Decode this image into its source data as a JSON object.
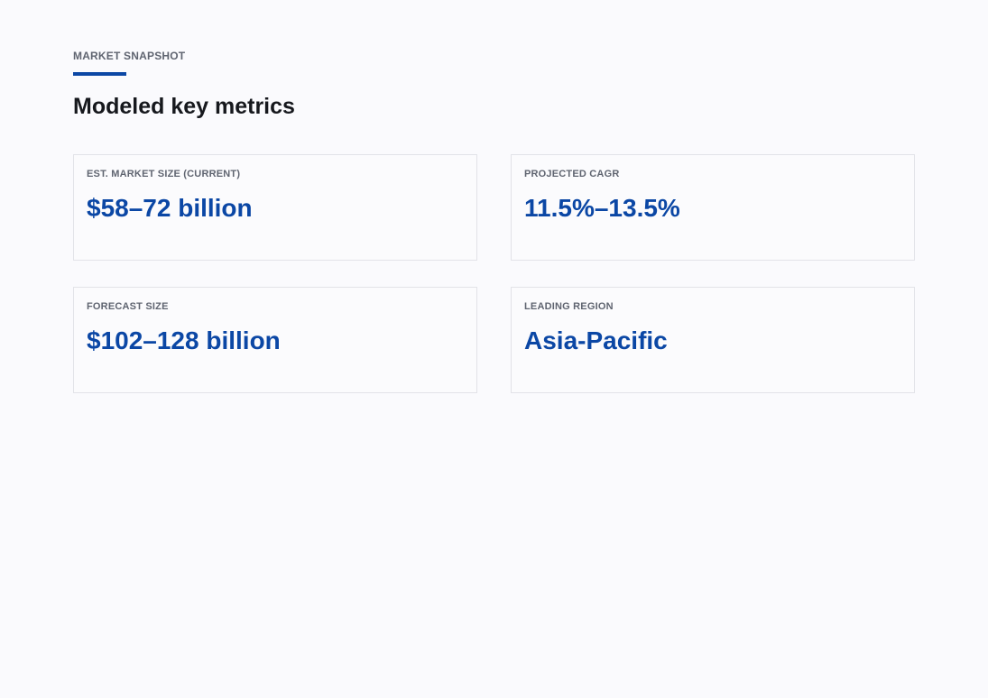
{
  "header": {
    "eyebrow": "MARKET SNAPSHOT",
    "title": "Modeled key metrics"
  },
  "colors": {
    "accent": "#0b47a5",
    "value": "#0b47a5"
  },
  "metrics": [
    {
      "label": "EST. MARKET SIZE (CURRENT)",
      "value": "$58–72 billion"
    },
    {
      "label": "PROJECTED CAGR",
      "value": "11.5%–13.5%"
    },
    {
      "label": "FORECAST SIZE",
      "value": "$102–128 billion"
    },
    {
      "label": "LEADING REGION",
      "value": "Asia-Pacific"
    }
  ]
}
